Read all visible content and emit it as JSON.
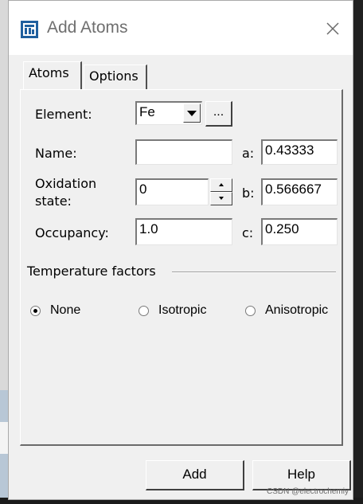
{
  "window": {
    "title": "Add Atoms",
    "icon": "app-icon",
    "close_icon": "close-icon"
  },
  "tabs": [
    {
      "label": "Atoms",
      "active": true
    },
    {
      "label": "Options",
      "active": false
    }
  ],
  "form": {
    "element_label": "Element:",
    "element_value": "Fe",
    "element_more_label": "...",
    "name_label": "Name:",
    "name_value": "",
    "oxidation_label_line1": "Oxidation",
    "oxidation_label_line2": "state:",
    "oxidation_value": "0",
    "occupancy_label": "Occupancy:",
    "occupancy_value": "1.0",
    "a_label": "a:",
    "a_value": "0.43333",
    "b_label": "b:",
    "b_value": "0.566667",
    "c_label": "c:",
    "c_value": "0.250"
  },
  "temperature": {
    "group_label": "Temperature factors",
    "options": [
      {
        "label": "None",
        "checked": true
      },
      {
        "label": "Isotropic",
        "checked": false
      },
      {
        "label": "Anisotropic",
        "checked": false
      }
    ]
  },
  "footer": {
    "add_label": "Add",
    "help_label": "Help"
  },
  "watermark": "CSDN @electrochemiy"
}
